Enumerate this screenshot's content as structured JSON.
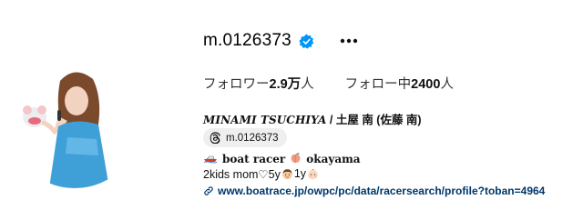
{
  "profile": {
    "username": "m.0126373",
    "verified_icon": "verified-badge-icon",
    "more_icon": "more-options-icon",
    "accent_color": "#0095f6"
  },
  "stats": {
    "followers_label": "フォロワー",
    "followers_count": "2.9万",
    "followers_unit": "人",
    "following_label": "フォロー中",
    "following_count": "2400",
    "following_unit": "人"
  },
  "bio": {
    "full_name_latin": "MINAMI TSUCHIYA",
    "full_name_sep": " / ",
    "full_name_jp": "土屋 南 (佐藤 南)",
    "threads_handle": "m.0126373",
    "line1_text1": "boat racer",
    "line1_text2": "okayama",
    "line2_text1": "2kids mom♡5y",
    "line2_text2": "1y",
    "link": "www.boatrace.jp/owpc/pc/data/racersearch/profile?toban=4964",
    "link_color": "#00376b"
  }
}
